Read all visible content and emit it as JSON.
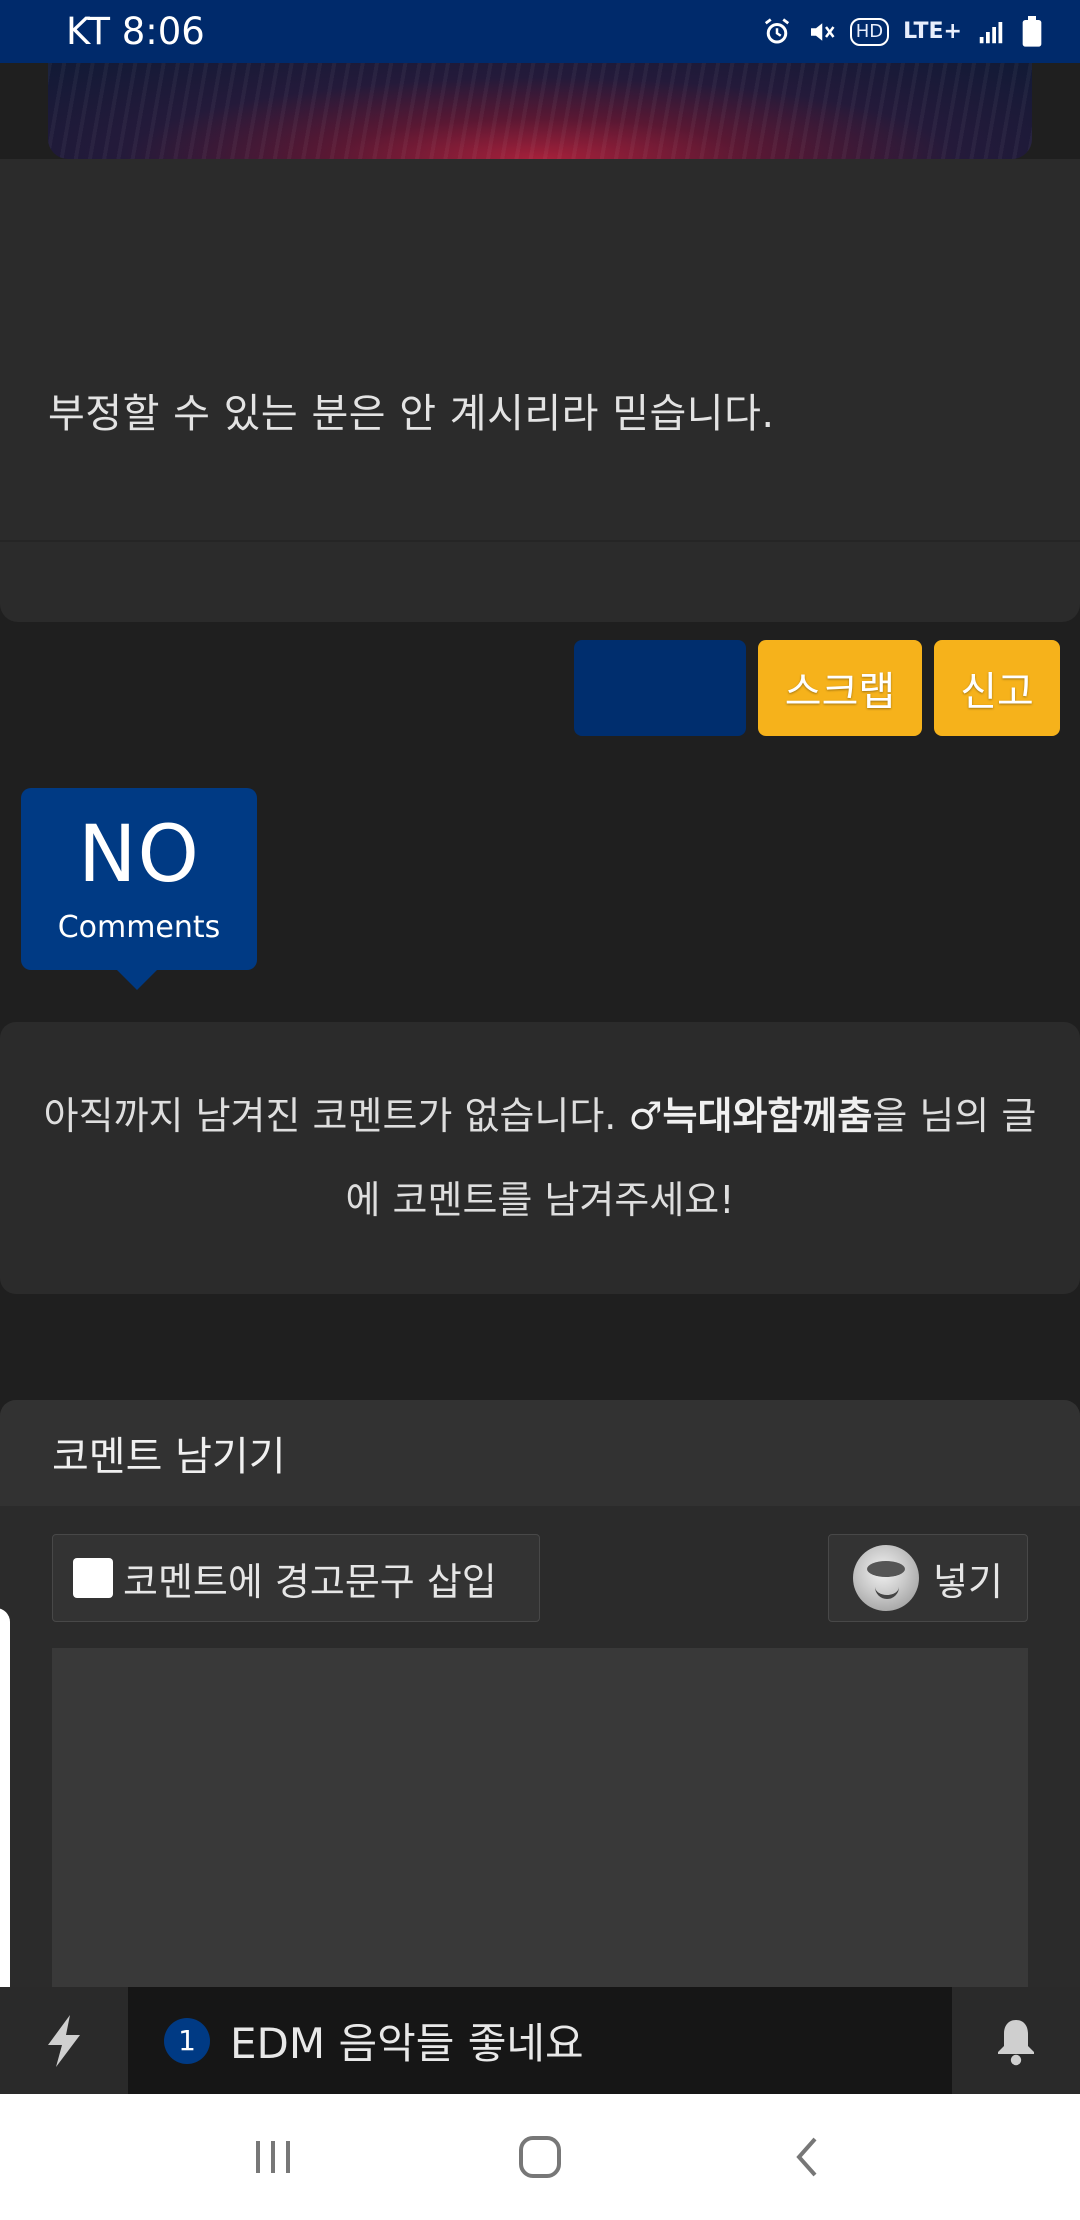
{
  "status_bar": {
    "time": "KT 8:06",
    "icons": [
      "alarm-icon",
      "vibrate-mute-icon",
      "hd-icon",
      "lte-icon",
      "signal-icon",
      "battery-icon"
    ],
    "hd_label": "HD",
    "lte_label": "LTE+"
  },
  "article": {
    "text": "부정할 수 있는 분은 안 계시리라 믿습니다."
  },
  "actions": {
    "blank_label": "",
    "scrap_label": "스크랩",
    "report_label": "신고"
  },
  "comments_badge": {
    "count_label": "NO",
    "sub_label": "Comments"
  },
  "empty_message": {
    "prefix": "아직까지 남겨진 코멘트가 없습니다. ",
    "author": "♂늑대와함께춤",
    "suffix": "을 님의 글에 코멘트를 남겨주세요!"
  },
  "comment_form": {
    "title": "코멘트 남기기",
    "warning_checkbox_label": "코멘트에 경고문구 삽입",
    "warning_checked": false,
    "insert_button_label": "넣기",
    "textarea_value": ""
  },
  "notification_bar": {
    "count": "1",
    "text": "EDM 음악들 좋네요"
  },
  "colors": {
    "primary_blue": "#003a84",
    "accent_yellow": "#f6b21b",
    "background": "#1f1f1f",
    "card": "#2b2b2b"
  }
}
